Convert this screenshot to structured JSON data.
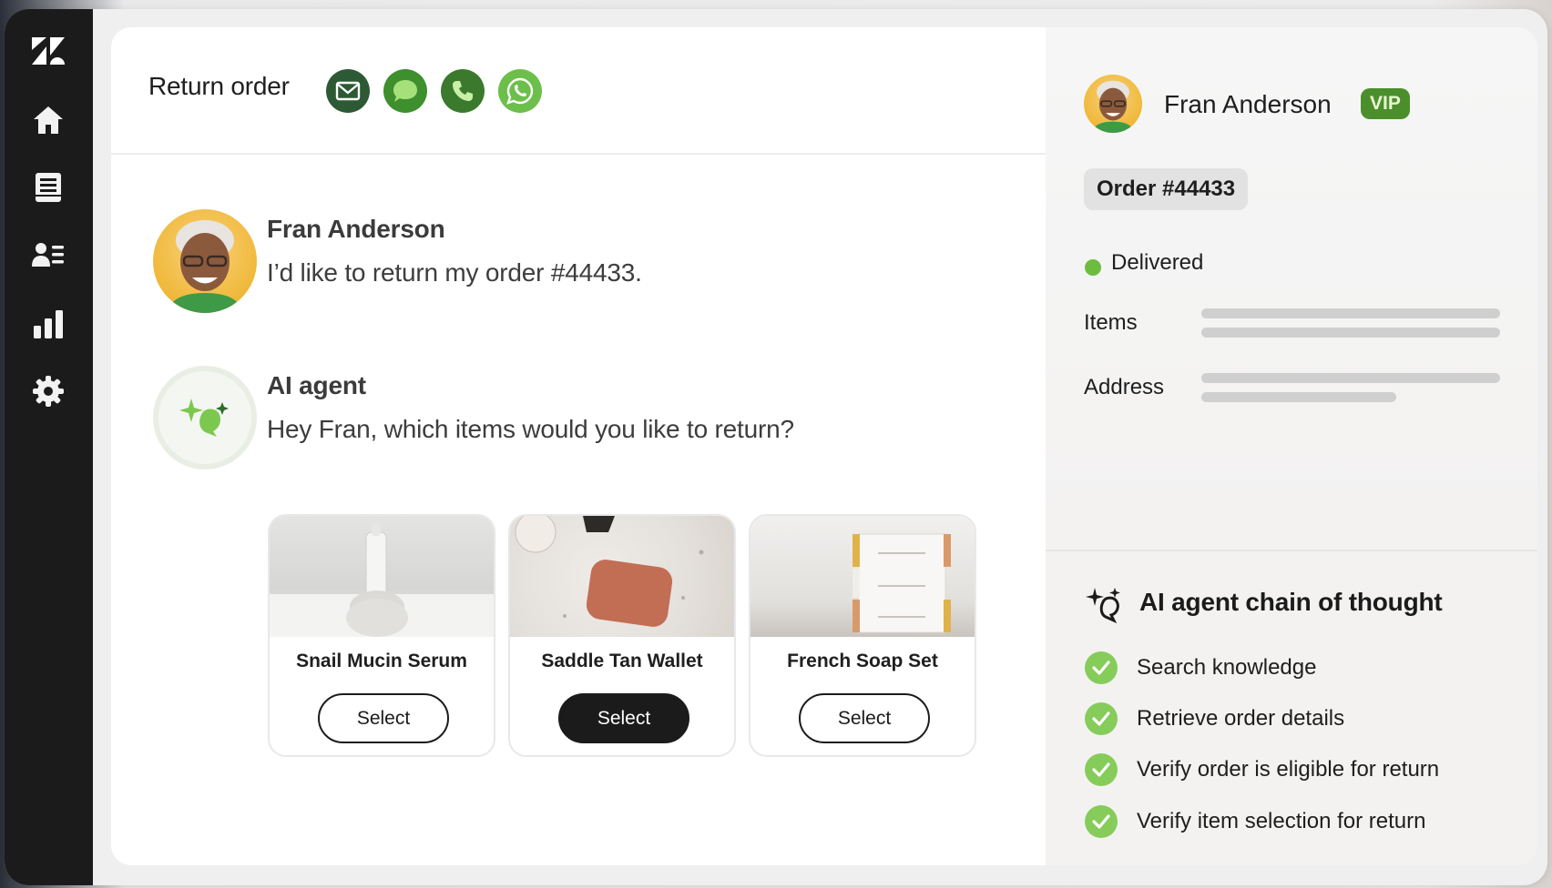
{
  "colors": {
    "sidebar_bg": "#1b1b1b",
    "accent_green": "#6cbd3f",
    "vip_bg": "#4b8f2c",
    "check_green": "#86cc5a"
  },
  "sidebar": {
    "items": [
      {
        "icon": "zendesk-logo-icon"
      },
      {
        "icon": "home-icon"
      },
      {
        "icon": "tickets-icon"
      },
      {
        "icon": "contacts-icon"
      },
      {
        "icon": "reports-icon"
      },
      {
        "icon": "settings-icon"
      }
    ]
  },
  "header": {
    "title": "Return order",
    "channels": [
      {
        "icon": "email-icon",
        "color": "#2d5a34"
      },
      {
        "icon": "chat-icon",
        "color": "#3e8f2e"
      },
      {
        "icon": "phone-icon",
        "color": "#3b7a2c"
      },
      {
        "icon": "whatsapp-icon",
        "color": "#6cbf4a"
      }
    ]
  },
  "conversation": {
    "customer": {
      "name": "Fran Anderson",
      "text": "I’d like to return my order #44433."
    },
    "agent": {
      "name": "AI agent",
      "text": "Hey Fran, which items would you like to return?"
    }
  },
  "products": [
    {
      "name": "Snail Mucin Serum",
      "button": "Select",
      "selected": false
    },
    {
      "name": "Saddle Tan Wallet",
      "button": "Select",
      "selected": true
    },
    {
      "name": "French Soap Set",
      "button": "Select",
      "selected": false
    }
  ],
  "customer_panel": {
    "name": "Fran Anderson",
    "badge": "VIP",
    "order": "Order #44433",
    "status": "Delivered",
    "fields": [
      "Items",
      "Address"
    ]
  },
  "chain_of_thought": {
    "title": "AI agent chain of thought",
    "steps": [
      "Search knowledge",
      "Retrieve order details",
      "Verify order is eligible for return",
      "Verify item selection for return"
    ]
  }
}
